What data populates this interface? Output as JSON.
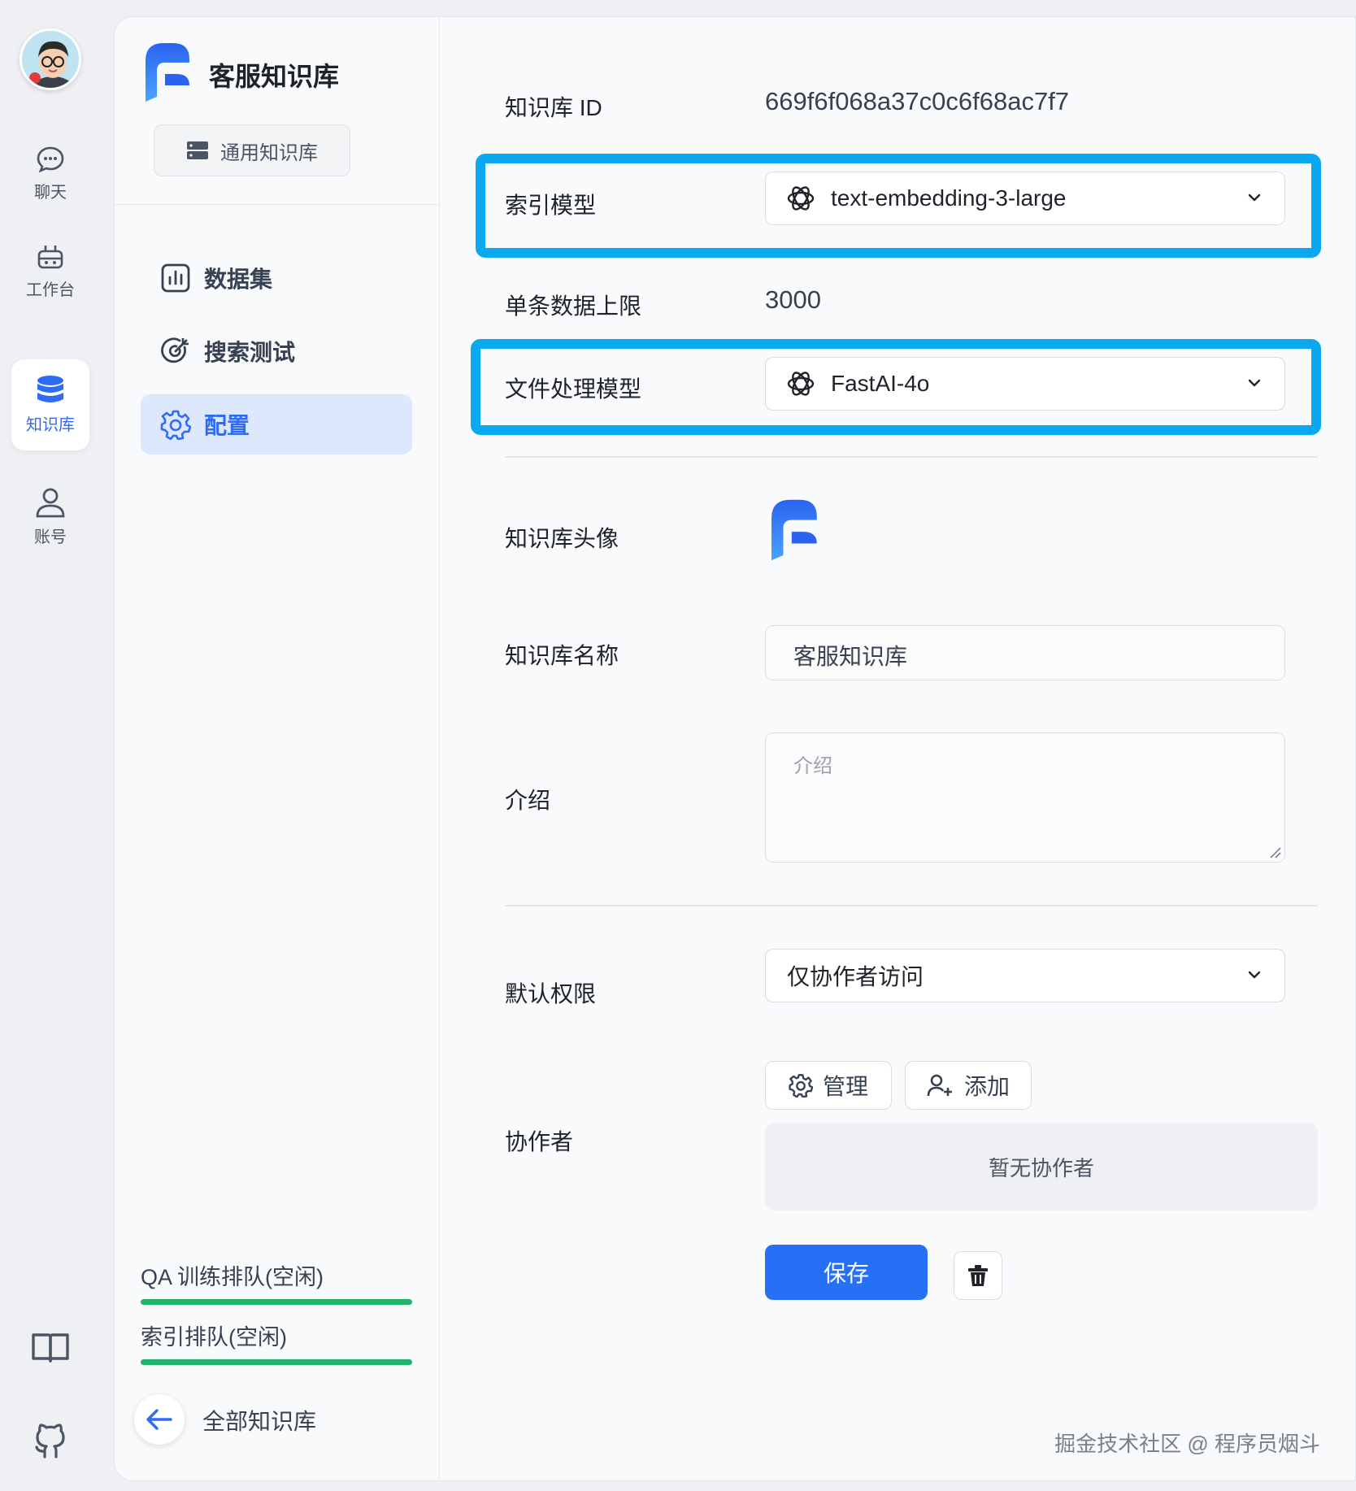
{
  "nav": {
    "items": [
      {
        "label": "聊天",
        "icon": "chat-icon"
      },
      {
        "label": "工作台",
        "icon": "robot-icon"
      },
      {
        "label": "知识库",
        "icon": "database-icon",
        "active": true
      },
      {
        "label": "账号",
        "icon": "user-icon"
      }
    ],
    "bottom_icons": [
      "book-icon",
      "github-icon"
    ]
  },
  "sidebar": {
    "kb_name": "客服知识库",
    "kb_type": "通用知识库",
    "menu": [
      {
        "label": "数据集",
        "icon": "bar-chart-icon"
      },
      {
        "label": "搜索测试",
        "icon": "target-icon"
      },
      {
        "label": "配置",
        "icon": "gear-icon",
        "active": true
      }
    ],
    "queues": [
      {
        "label": "QA 训练排队(空闲)",
        "progress": 1.0
      },
      {
        "label": "索引排队(空闲)",
        "progress": 1.0
      }
    ],
    "back_label": "全部知识库"
  },
  "config": {
    "id_label": "知识库 ID",
    "id_value": "669f6f068a37c0c6f68ac7f7",
    "index_model_label": "索引模型",
    "index_model_value": "text-embedding-3-large",
    "max_data_label": "单条数据上限",
    "max_data_value": "3000",
    "file_model_label": "文件处理模型",
    "file_model_value": "FastAI-4o",
    "avatar_label": "知识库头像",
    "name_label": "知识库名称",
    "name_value": "客服知识库",
    "intro_label": "介绍",
    "intro_placeholder": "介绍",
    "permission_label": "默认权限",
    "permission_value": "仅协作者访问",
    "collab_label": "协作者",
    "manage_label": "管理",
    "add_label": "添加",
    "empty_collab": "暂无协作者",
    "save_label": "保存"
  },
  "watermark": "掘金技术社区 @ 程序员烟斗",
  "colors": {
    "accent": "#2f6cf6",
    "highlight": "#0aa8ee",
    "queue_bar": "#22b36b",
    "save_button": "#2670f6"
  }
}
